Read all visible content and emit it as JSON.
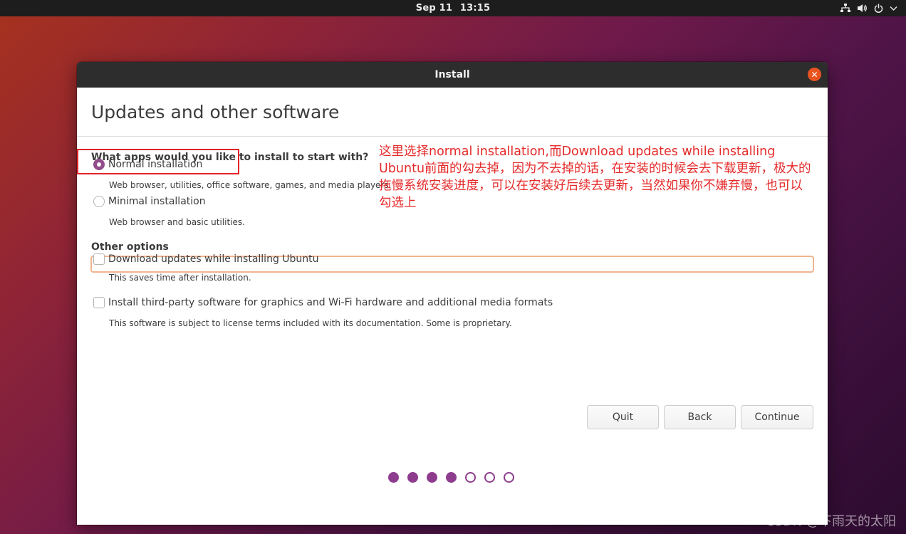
{
  "topbar": {
    "date": "Sep 11",
    "time": "13:15",
    "icons": [
      "network-icon",
      "volume-icon",
      "power-icon",
      "chevron-down-icon"
    ]
  },
  "window": {
    "title": "Install",
    "close_icon": "close-icon"
  },
  "page": {
    "title": "Updates and other software",
    "question": "What apps would you like to install to start with?",
    "options": [
      {
        "label": "Normal installation",
        "desc": "Web browser, utilities, office software, games, and media players.",
        "selected": true
      },
      {
        "label": "Minimal installation",
        "desc": "Web browser and basic utilities.",
        "selected": false
      }
    ],
    "other_heading": "Other options",
    "checkboxes": [
      {
        "label": "Download updates while installing Ubuntu",
        "desc": "This saves time after installation.",
        "checked": false
      },
      {
        "label": "Install third-party software for graphics and Wi-Fi hardware and additional media formats",
        "desc": "This software is subject to license terms included with its documentation. Some is proprietary.",
        "checked": false
      }
    ]
  },
  "annotation": "这里选择normal installation,而Download updates while installing Ubuntu前面的勾去掉，因为不去掉的话，在安装的时候会去下载更新，极大的拖慢系统安装进度，可以在安装好后续去更新，当然如果你不嫌弃慢，也可以勾选上",
  "buttons": {
    "quit": "Quit",
    "back": "Back",
    "continue": "Continue"
  },
  "progress": {
    "current_step": 4,
    "total_steps": 7
  },
  "watermark": "CSDN @下雨天的太阳",
  "colors": {
    "accent": "#924d8b",
    "close": "#e95420",
    "annotation": "#e52a2a",
    "topbar": "#1d1d1d"
  }
}
